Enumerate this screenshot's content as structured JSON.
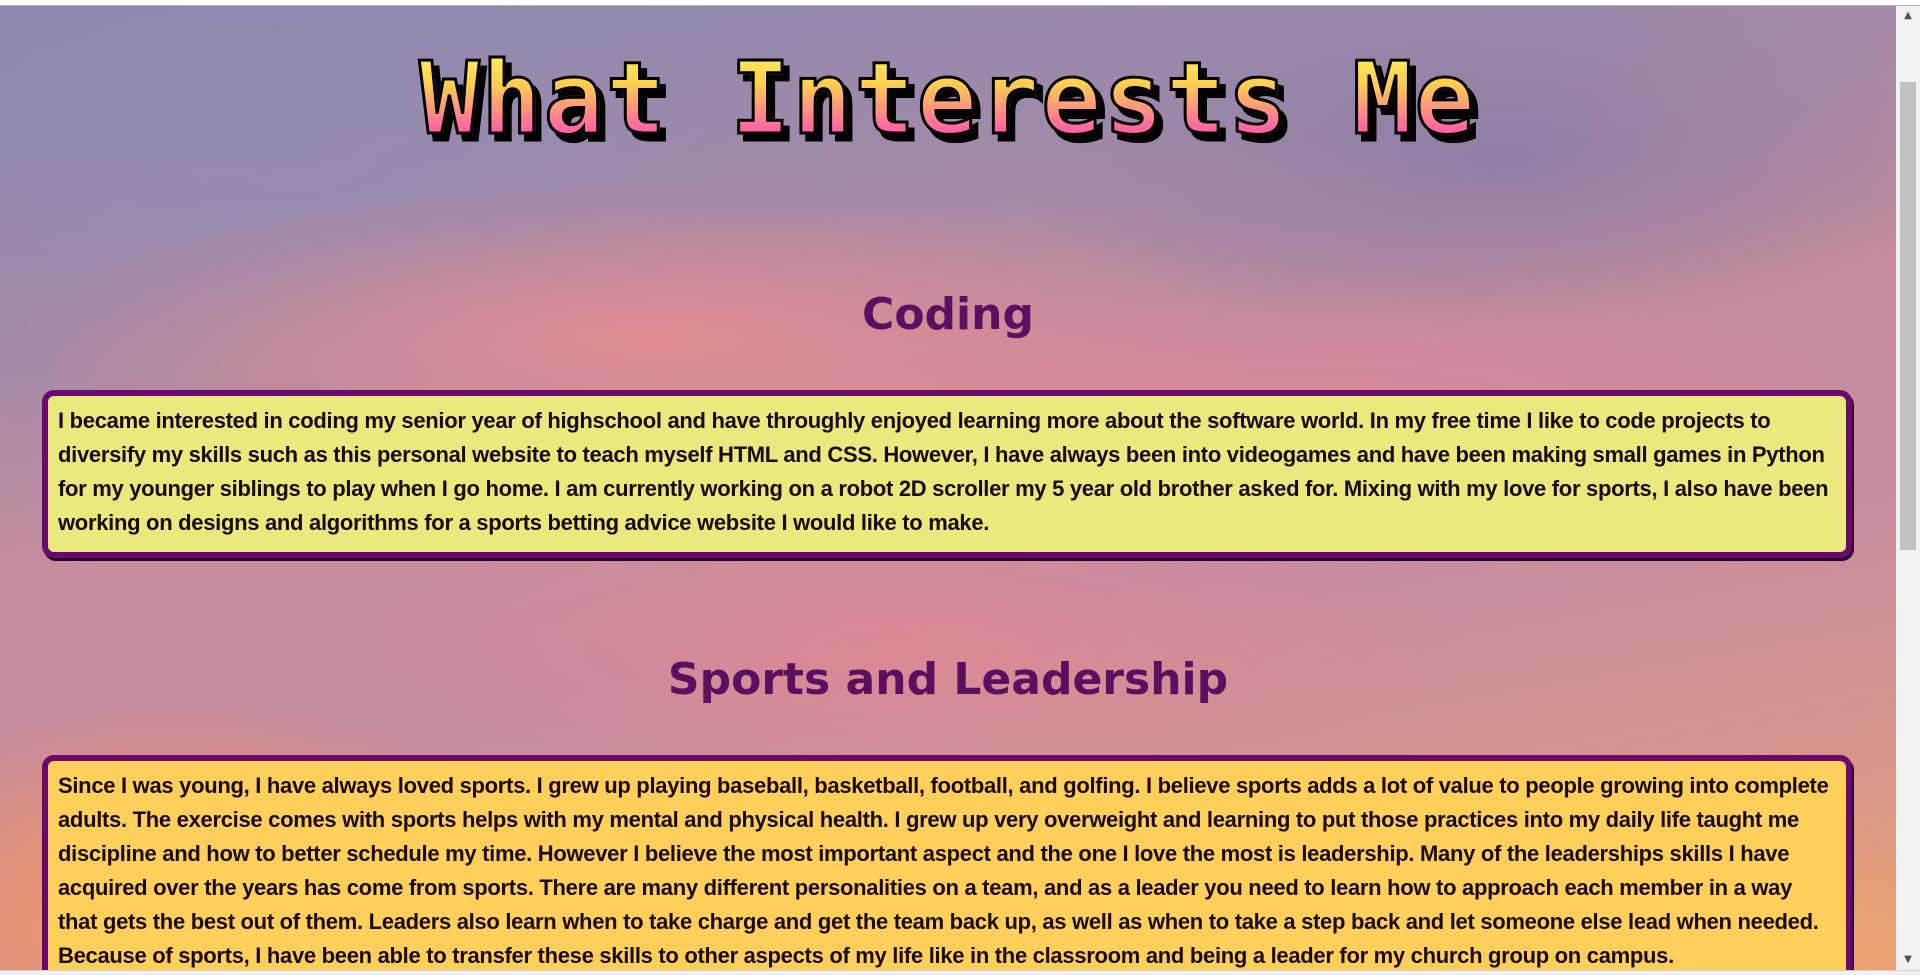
{
  "page": {
    "title": "What Interests Me"
  },
  "sections": [
    {
      "heading": "Coding",
      "body": "I became interested in coding my senior year of highschool and have throughly enjoyed learning more about the software world. In my free time I like to code projects to diversify my skills such as this personal website to teach myself HTML and CSS. However, I have always been into videogames and have been making small games in Python for my younger siblings to play when I go home. I am currently working on a robot 2D scroller my 5 year old brother asked for. Mixing with my love for sports, I also have been working on designs and algorithms for a sports betting advice website I would like to make."
    },
    {
      "heading": "Sports and Leadership",
      "body": "Since I was young, I have always loved sports. I grew up playing baseball, basketball, football, and golfing. I believe sports adds a lot of value to people growing into complete adults. The exercise comes with sports helps with my mental and physical health. I grew up very overweight and learning to put those practices into my daily life taught me discipline and how to better schedule my time. However I believe the most important aspect and the one I love the most is leadership. Many of the leaderships skills I have acquired over the years has come from sports. There are many different personalities on a team, and as a leader you need to learn how to approach each member in a way that gets the best out of them. Leaders also learn when to take charge and get the team back up, as well as when to take a step back and let someone else lead when needed. Because of sports, I have been able to transfer these skills to other aspects of my life like in the classroom and being a leader for my church group on campus."
    }
  ],
  "colors": {
    "heading": "#5b0f5f",
    "box_border": "#6a0a6e",
    "coding_box_bg": "#e9e97e",
    "sports_box_bg": "#ffcf5c"
  },
  "scrollbar": {
    "up_icon": "scroll-up-arrow-icon",
    "down_icon": "scroll-down-arrow-icon"
  }
}
